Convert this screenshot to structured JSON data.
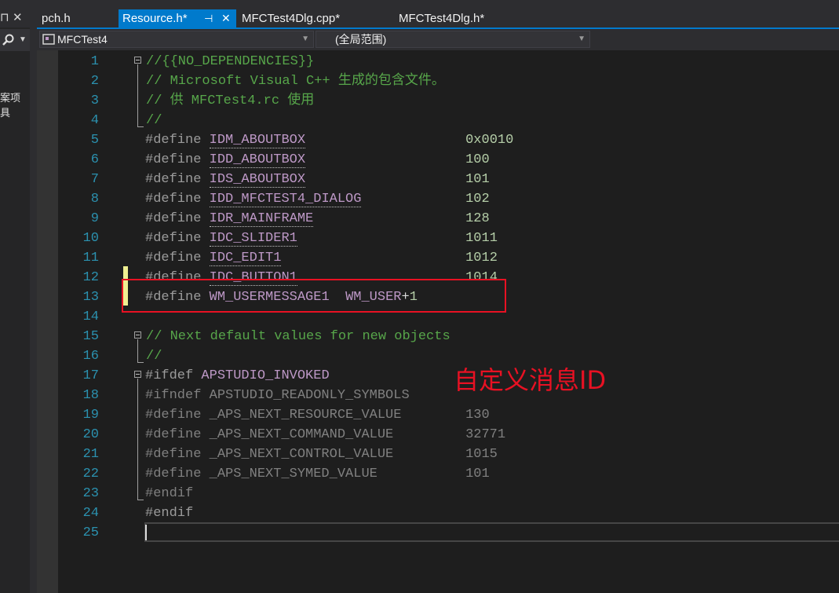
{
  "left_panel": {
    "label_1": "案项",
    "label_2": "具"
  },
  "tabs": [
    {
      "label": "pch.h",
      "active": false
    },
    {
      "label": "Resource.h*",
      "active": true
    },
    {
      "label": "MFCTest4Dlg.cpp*",
      "active": false
    },
    {
      "label": "MFCTest4Dlg.h*",
      "active": false
    }
  ],
  "nav": {
    "project": "MFCTest4",
    "scope": "(全局范围)"
  },
  "code_lines": [
    {
      "n": "1",
      "parts": [
        [
          "c-comment",
          "//{{NO_DEPENDENCIES}}"
        ]
      ]
    },
    {
      "n": "2",
      "parts": [
        [
          "c-comment",
          "// Microsoft Visual C++ 生成的包含文件。"
        ]
      ]
    },
    {
      "n": "3",
      "parts": [
        [
          "c-comment",
          "// 供 MFCTest4.rc 使用"
        ]
      ]
    },
    {
      "n": "4",
      "parts": [
        [
          "c-comment",
          "//"
        ]
      ]
    },
    {
      "n": "5",
      "parts": [
        [
          "c-kw",
          "#define "
        ],
        [
          "c-macro-u",
          "IDM_ABOUTBOX"
        ],
        [
          "c-text",
          "                    "
        ],
        [
          "c-num",
          "0x0010"
        ]
      ]
    },
    {
      "n": "6",
      "parts": [
        [
          "c-kw",
          "#define "
        ],
        [
          "c-macro-u",
          "IDD_ABOUTBOX"
        ],
        [
          "c-text",
          "                    "
        ],
        [
          "c-num",
          "100"
        ]
      ]
    },
    {
      "n": "7",
      "parts": [
        [
          "c-kw",
          "#define "
        ],
        [
          "c-macro-u",
          "IDS_ABOUTBOX"
        ],
        [
          "c-text",
          "                    "
        ],
        [
          "c-num",
          "101"
        ]
      ]
    },
    {
      "n": "8",
      "parts": [
        [
          "c-kw",
          "#define "
        ],
        [
          "c-macro-u",
          "IDD_MFCTEST4_DIALOG"
        ],
        [
          "c-text",
          "             "
        ],
        [
          "c-num",
          "102"
        ]
      ]
    },
    {
      "n": "9",
      "parts": [
        [
          "c-kw",
          "#define "
        ],
        [
          "c-macro-u",
          "IDR_MAINFRAME"
        ],
        [
          "c-text",
          "                   "
        ],
        [
          "c-num",
          "128"
        ]
      ]
    },
    {
      "n": "10",
      "parts": [
        [
          "c-kw",
          "#define "
        ],
        [
          "c-macro-u",
          "IDC_SLIDER1"
        ],
        [
          "c-text",
          "                     "
        ],
        [
          "c-num",
          "1011"
        ]
      ]
    },
    {
      "n": "11",
      "parts": [
        [
          "c-kw",
          "#define "
        ],
        [
          "c-macro-u",
          "IDC_EDIT1"
        ],
        [
          "c-text",
          "                       "
        ],
        [
          "c-num",
          "1012"
        ]
      ]
    },
    {
      "n": "12",
      "parts": [
        [
          "c-kw",
          "#define "
        ],
        [
          "c-macro-u",
          "IDC_BUTTON1"
        ],
        [
          "c-text",
          "                     "
        ],
        [
          "c-num",
          "1014"
        ]
      ]
    },
    {
      "n": "13",
      "parts": [
        [
          "c-kw",
          "#define "
        ],
        [
          "c-macro",
          "WM_USERMESSAGE1"
        ],
        [
          "c-text",
          "  "
        ],
        [
          "c-macro",
          "WM_USER"
        ],
        [
          "c-text",
          "+"
        ],
        [
          "c-num",
          "1"
        ]
      ]
    },
    {
      "n": "14",
      "parts": []
    },
    {
      "n": "15",
      "parts": [
        [
          "c-comment",
          "// Next default values for new objects"
        ]
      ]
    },
    {
      "n": "16",
      "parts": [
        [
          "c-comment",
          "//"
        ]
      ]
    },
    {
      "n": "17",
      "parts": [
        [
          "c-kw",
          "#ifdef "
        ],
        [
          "c-macro",
          "APSTUDIO_INVOKED"
        ]
      ]
    },
    {
      "n": "18",
      "parts": [
        [
          "c-dim",
          "#ifndef APSTUDIO_READONLY_SYMBOLS"
        ]
      ]
    },
    {
      "n": "19",
      "parts": [
        [
          "c-dim",
          "#define _APS_NEXT_RESOURCE_VALUE        130"
        ]
      ]
    },
    {
      "n": "20",
      "parts": [
        [
          "c-dim",
          "#define _APS_NEXT_COMMAND_VALUE         32771"
        ]
      ]
    },
    {
      "n": "21",
      "parts": [
        [
          "c-dim",
          "#define _APS_NEXT_CONTROL_VALUE         1015"
        ]
      ]
    },
    {
      "n": "22",
      "parts": [
        [
          "c-dim",
          "#define _APS_NEXT_SYMED_VALUE           101"
        ]
      ]
    },
    {
      "n": "23",
      "parts": [
        [
          "c-dim",
          "#endif"
        ]
      ]
    },
    {
      "n": "24",
      "parts": [
        [
          "c-kw",
          "#endif"
        ]
      ]
    },
    {
      "n": "25",
      "parts": []
    }
  ],
  "annotation": "自定义消息ID",
  "colors": {
    "accent": "#007acc",
    "highlight_box": "#e81123",
    "comment": "#57a64a",
    "macro": "#bd98c6",
    "number": "#b5cea8",
    "line_number": "#2b91af"
  }
}
